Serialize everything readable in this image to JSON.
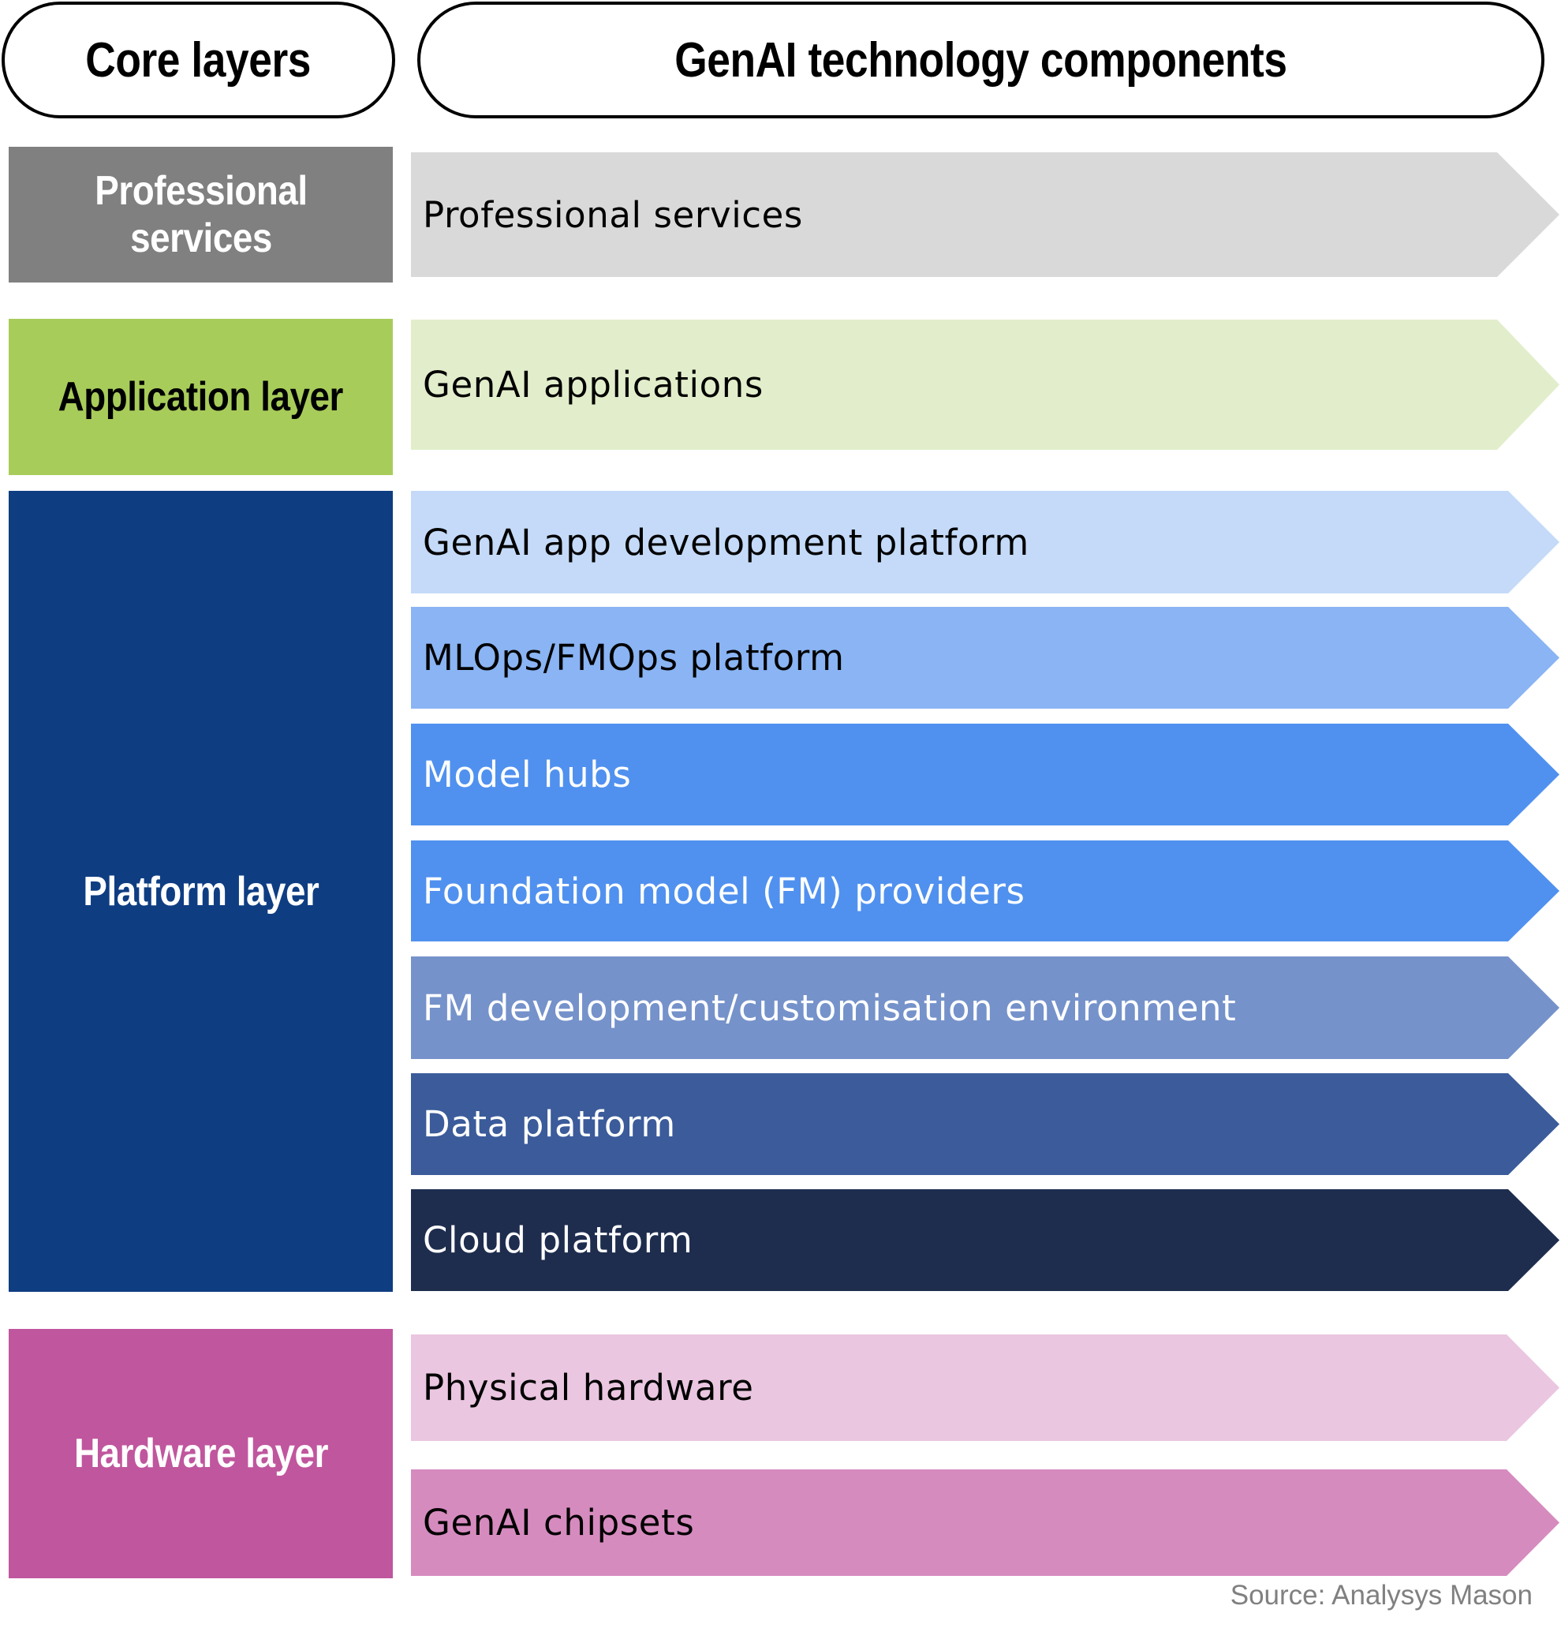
{
  "headers": {
    "core_layers": "Core layers",
    "components": "GenAI technology components"
  },
  "layers": [
    {
      "id": "professional",
      "label": "Professional services",
      "color": "#808080",
      "text_color": "#ffffff"
    },
    {
      "id": "application",
      "label": "Application layer",
      "color": "#a8cc5a",
      "text_color": "#000000"
    },
    {
      "id": "platform",
      "label": "Platform layer",
      "color": "#0e3d82",
      "text_color": "#ffffff"
    },
    {
      "id": "hardware",
      "label": "Hardware layer",
      "color": "#c0569e",
      "text_color": "#ffffff"
    }
  ],
  "components": [
    {
      "label": "Professional services",
      "layer": "professional",
      "color": "#d9d9d9",
      "text_color": "#000000"
    },
    {
      "label": "GenAI applications",
      "layer": "application",
      "color": "#e2eecb",
      "text_color": "#000000"
    },
    {
      "label": "GenAI app development platform",
      "layer": "platform",
      "color": "#c4daf8",
      "text_color": "#000000"
    },
    {
      "label": "MLOps/FMOps platform",
      "layer": "platform",
      "color": "#8ab4f3",
      "text_color": "#000000"
    },
    {
      "label": "Model hubs",
      "layer": "platform",
      "color": "#5091ef",
      "text_color": "#ffffff"
    },
    {
      "label": "Foundation model (FM) providers",
      "layer": "platform",
      "color": "#5091ef",
      "text_color": "#ffffff"
    },
    {
      "label": "FM development/customisation environment",
      "layer": "platform",
      "color": "#7592ca",
      "text_color": "#ffffff"
    },
    {
      "label": "Data platform",
      "layer": "platform",
      "color": "#3b5b9a",
      "text_color": "#ffffff"
    },
    {
      "label": "Cloud platform",
      "layer": "platform",
      "color": "#1e2d4e",
      "text_color": "#ffffff"
    },
    {
      "label": "Physical hardware",
      "layer": "hardware",
      "color": "#eac6e0",
      "text_color": "#000000"
    },
    {
      "label": "GenAI chipsets",
      "layer": "hardware",
      "color": "#d68bbf",
      "text_color": "#000000"
    }
  ],
  "source": "Source: Analysys Mason"
}
